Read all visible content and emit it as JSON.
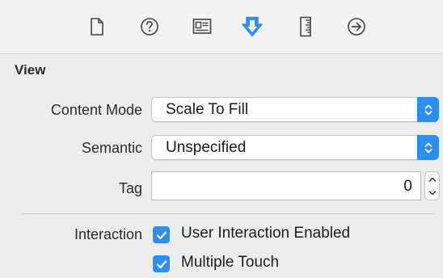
{
  "toolbar": {
    "tabs": [
      {
        "icon": "file-icon"
      },
      {
        "icon": "help-icon"
      },
      {
        "icon": "identity-icon"
      },
      {
        "icon": "attributes-icon",
        "selected": true
      },
      {
        "icon": "size-icon"
      },
      {
        "icon": "connections-icon"
      }
    ],
    "accent_color": "#2f8ef4"
  },
  "section": {
    "title": "View"
  },
  "content_mode": {
    "label": "Content Mode",
    "value": "Scale To Fill"
  },
  "semantic": {
    "label": "Semantic",
    "value": "Unspecified"
  },
  "tag": {
    "label": "Tag",
    "value": "0"
  },
  "interaction": {
    "label": "Interaction",
    "user_interaction_enabled": {
      "label": "User Interaction Enabled",
      "checked": true
    },
    "multiple_touch": {
      "label": "Multiple Touch",
      "checked": true
    }
  }
}
